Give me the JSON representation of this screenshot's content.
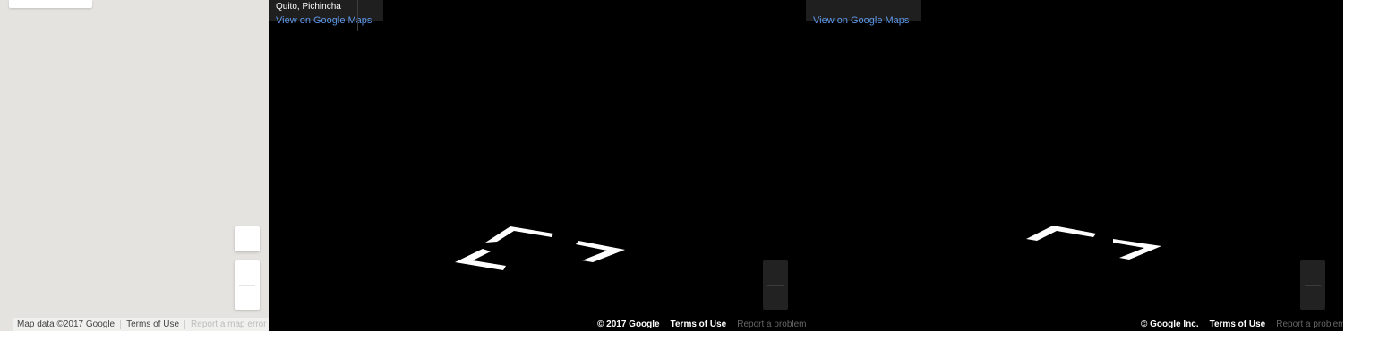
{
  "map": {
    "footer": {
      "data": "Map data ©2017 Google",
      "terms": "Terms of Use",
      "report": "Report a map error"
    }
  },
  "panes": [
    {
      "address": "Quito, Pichincha",
      "view_link": "View on Google Maps",
      "footer": {
        "copyright": "© 2017 Google",
        "terms": "Terms of Use",
        "report": "Report a problem"
      },
      "nav_arrows": 3
    },
    {
      "address": "",
      "view_link": "View on Google Maps",
      "footer": {
        "copyright": "© Google Inc.",
        "terms": "Terms of Use",
        "report": "Report a problem"
      },
      "nav_arrows": 2
    }
  ],
  "colors": {
    "map_background": "#e5e3df",
    "streetview_background": "#000000",
    "link": "#5d97e8",
    "control_dark": "#222222"
  }
}
